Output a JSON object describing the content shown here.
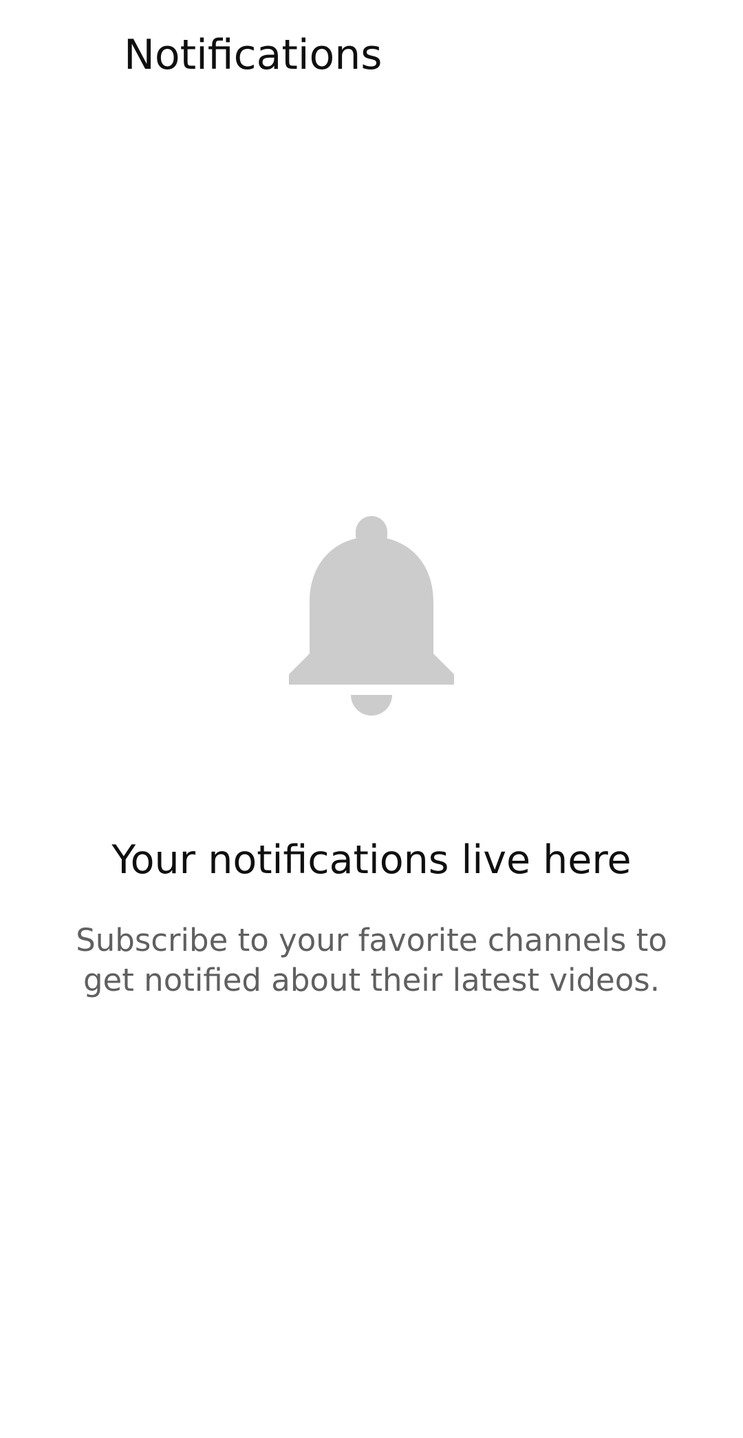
{
  "header": {
    "title": "Notifications"
  },
  "empty_state": {
    "icon": "bell-icon",
    "icon_color": "#cccccc",
    "title": "Your notifications live here",
    "subtitle": "Subscribe to your favorite channels to get notified about their latest videos."
  },
  "colors": {
    "background": "#ffffff",
    "title_text": "#0f0f0f",
    "secondary_text": "#606060"
  }
}
